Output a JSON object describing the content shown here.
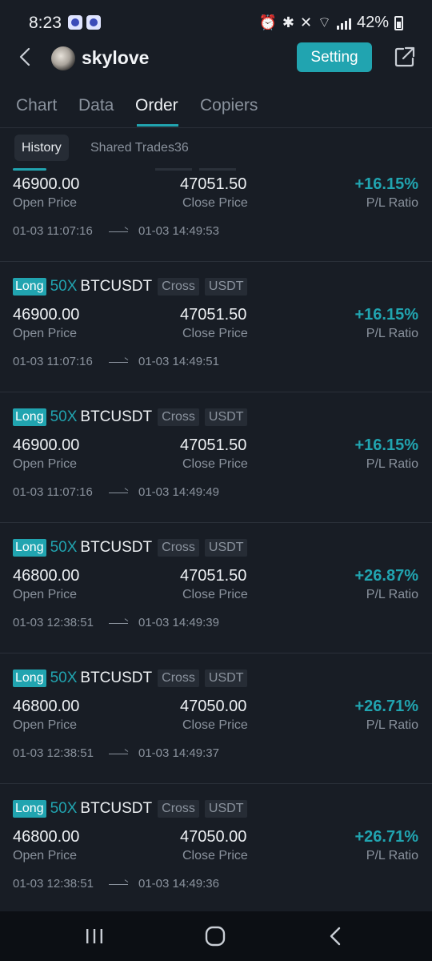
{
  "status_bar": {
    "time": "8:23",
    "battery_pct": "42%"
  },
  "header": {
    "username": "skylove",
    "setting_label": "Setting"
  },
  "tabs": [
    {
      "label": "Chart"
    },
    {
      "label": "Data"
    },
    {
      "label": "Order"
    },
    {
      "label": "Copiers"
    }
  ],
  "active_tab": "Order",
  "subtabs": [
    {
      "label": "History"
    },
    {
      "label": "Shared Trades36"
    }
  ],
  "labels": {
    "open_price": "Open Price",
    "close_price": "Close Price",
    "pl_ratio": "P/L Ratio"
  },
  "orders": [
    {
      "side": "",
      "leverage": "",
      "symbol": "",
      "margin": "",
      "currency": "",
      "open": "46900.00",
      "close": "47051.50",
      "pl": "+16.15%",
      "open_time": "01-03 11:07:16",
      "close_time": "01-03 14:49:53"
    },
    {
      "side": "Long",
      "leverage": "50X",
      "symbol": "BTCUSDT",
      "margin": "Cross",
      "currency": "USDT",
      "open": "46900.00",
      "close": "47051.50",
      "pl": "+16.15%",
      "open_time": "01-03 11:07:16",
      "close_time": "01-03 14:49:51"
    },
    {
      "side": "Long",
      "leverage": "50X",
      "symbol": "BTCUSDT",
      "margin": "Cross",
      "currency": "USDT",
      "open": "46900.00",
      "close": "47051.50",
      "pl": "+16.15%",
      "open_time": "01-03 11:07:16",
      "close_time": "01-03 14:49:49"
    },
    {
      "side": "Long",
      "leverage": "50X",
      "symbol": "BTCUSDT",
      "margin": "Cross",
      "currency": "USDT",
      "open": "46800.00",
      "close": "47051.50",
      "pl": "+26.87%",
      "open_time": "01-03 12:38:51",
      "close_time": "01-03 14:49:39"
    },
    {
      "side": "Long",
      "leverage": "50X",
      "symbol": "BTCUSDT",
      "margin": "Cross",
      "currency": "USDT",
      "open": "46800.00",
      "close": "47050.00",
      "pl": "+26.71%",
      "open_time": "01-03 12:38:51",
      "close_time": "01-03 14:49:37"
    },
    {
      "side": "Long",
      "leverage": "50X",
      "symbol": "BTCUSDT",
      "margin": "Cross",
      "currency": "USDT",
      "open": "46800.00",
      "close": "47050.00",
      "pl": "+26.71%",
      "open_time": "01-03 12:38:51",
      "close_time": "01-03 14:49:36"
    }
  ],
  "colors": {
    "accent": "#21a4b0",
    "background": "#181d25",
    "muted": "#8a929d"
  },
  "icons": [
    "back-arrow-icon",
    "avatar",
    "share-external-icon",
    "recents-icon",
    "home-icon",
    "nav-back-icon"
  ]
}
